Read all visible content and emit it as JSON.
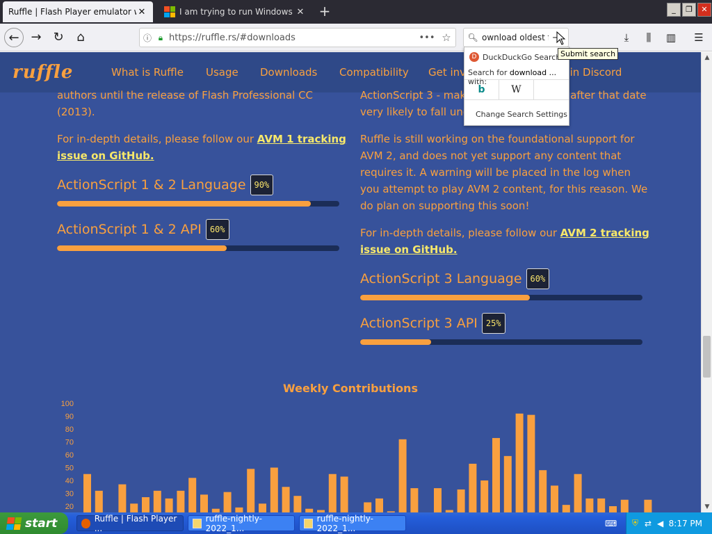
{
  "browser": {
    "tabs": [
      {
        "title": "Ruffle | Flash Player emulator writ",
        "active": true
      },
      {
        "title": "I am trying to run Windows Defen",
        "active": false
      }
    ],
    "url": "https://ruffle.rs/#downloads",
    "search_value": "ownload oldest f",
    "search_dropdown": {
      "engine": "DuckDuckGo Search",
      "search_for_prefix": "Search for ",
      "search_for_term": "download ...",
      "search_for_suffix": " with:",
      "engines": [
        "b",
        "W"
      ],
      "settings_label": "Change Search Settings"
    },
    "tooltip": "Submit search"
  },
  "site": {
    "logo": "ruffle",
    "nav": [
      "What is Ruffle",
      "Usage",
      "Downloads",
      "Compatibility",
      "Get inv",
      "Join Discord"
    ],
    "left": {
      "para1": "authors until the release of Flash Professional CC (2013).",
      "para2_prefix": "For in-depth details, please follow our ",
      "para2_link": "AVM 1 tracking issue on GitHub.",
      "meters": [
        {
          "label": "ActionScript 1 & 2 Language",
          "badge": "90%",
          "value": 0.9
        },
        {
          "label": "ActionScript 1 & 2 API",
          "badge": "60%",
          "value": 0.6
        }
      ]
    },
    "right": {
      "para1": "ActionScript 3 - mak",
      "para1_tail": "after that date",
      "para1_line2": "very likely to fall und",
      "para2": "Ruffle is still working on the foundational support for AVM 2, and does not yet support any content that requires it. A warning will be placed in the log when you attempt to play AVM 2 content, for this reason. We do plan on supporting this soon!",
      "para3_prefix": "For in-depth details, please follow our ",
      "para3_link": "AVM 2 tracking issue on GitHub.",
      "meters": [
        {
          "label": "ActionScript 3 Language",
          "badge": "60%",
          "value": 0.6
        },
        {
          "label": "ActionScript 3 API",
          "badge": "25%",
          "value": 0.25
        }
      ]
    }
  },
  "chart_data": {
    "type": "bar",
    "title": "Weekly Contributions",
    "ylim": [
      20,
      100
    ],
    "yticks": [
      20,
      30,
      40,
      50,
      60,
      70,
      80,
      90,
      100
    ],
    "values": [
      45,
      32,
      0,
      37,
      22,
      27,
      32,
      26,
      32,
      42,
      29,
      18,
      31,
      19,
      49,
      22,
      50,
      35,
      28,
      18,
      17,
      45,
      43,
      0,
      23,
      26,
      16,
      72,
      34,
      0,
      34,
      17,
      33,
      53,
      40,
      73,
      59,
      92,
      91,
      48,
      36,
      21,
      45,
      26,
      26,
      20,
      25,
      0,
      25,
      31,
      0
    ],
    "color": "#f9a03f"
  },
  "taskbar": {
    "start": "start",
    "tasks": [
      "Ruffle | Flash Player ...",
      "ruffle-nightly-2022_1...",
      "ruffle-nightly-2022_1..."
    ],
    "clock": "8:17 PM"
  }
}
